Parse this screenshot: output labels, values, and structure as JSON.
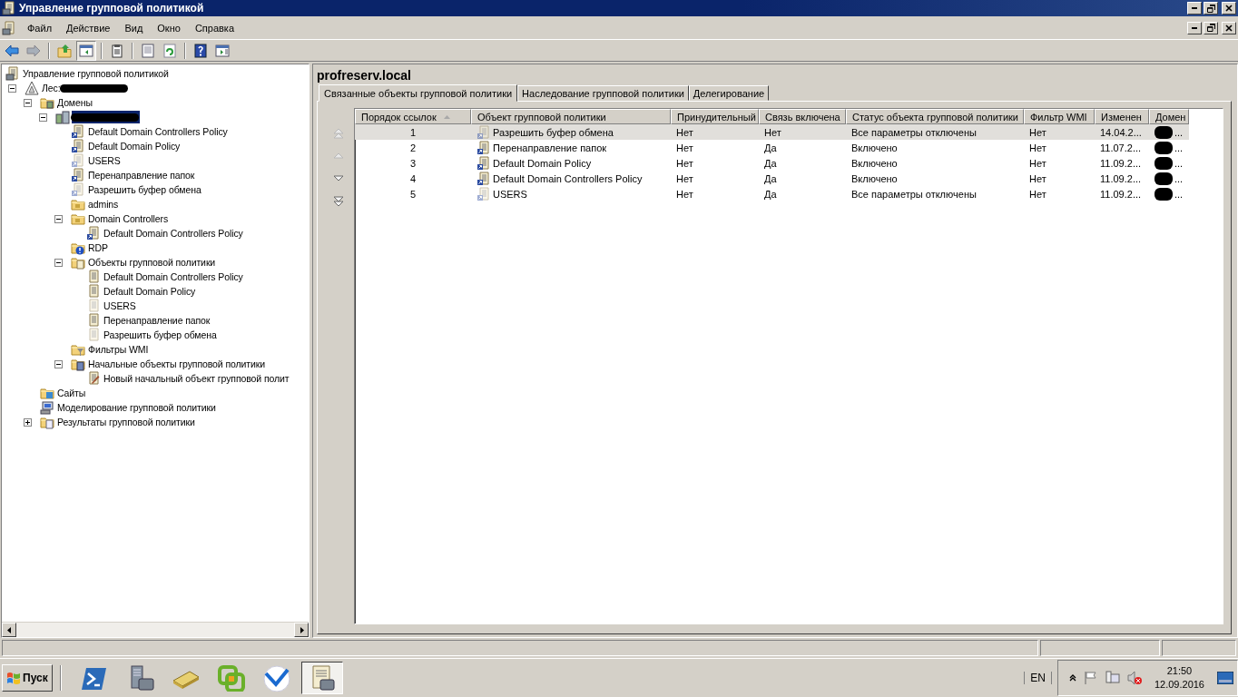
{
  "window": {
    "title": "Управление групповой политикой"
  },
  "menu": [
    "Файл",
    "Действие",
    "Вид",
    "Окно",
    "Справка"
  ],
  "toolbar": [
    {
      "kind": "back",
      "disabled": false,
      "pressed": false
    },
    {
      "kind": "forward",
      "disabled": true,
      "pressed": false
    },
    {
      "kind": "separator"
    },
    {
      "kind": "up",
      "disabled": false,
      "pressed": false
    },
    {
      "kind": "console-tree",
      "disabled": false,
      "pressed": true
    },
    {
      "kind": "separator"
    },
    {
      "kind": "clipboard",
      "disabled": false,
      "pressed": false
    },
    {
      "kind": "separator"
    },
    {
      "kind": "export",
      "disabled": false,
      "pressed": false
    },
    {
      "kind": "refresh",
      "disabled": false,
      "pressed": false
    },
    {
      "kind": "separator"
    },
    {
      "kind": "help",
      "disabled": false,
      "pressed": false
    },
    {
      "kind": "action-pane",
      "disabled": false,
      "pressed": false
    }
  ],
  "tree": {
    "label": "Управление групповой политикой",
    "kind": "root",
    "selected": false,
    "children": [
      {
        "label": "Лес:",
        "kind": "forest",
        "redacted": true,
        "selected": false,
        "expanded": true,
        "children": [
          {
            "label": "Домены",
            "kind": "domains",
            "selected": false,
            "expanded": true,
            "children": [
              {
                "kind": "domain",
                "redacted": true,
                "selected": true,
                "expanded": true,
                "children": [
                  {
                    "label": "Default Domain Controllers Policy",
                    "kind": "link",
                    "faded": false,
                    "selected": false
                  },
                  {
                    "label": "Default Domain Policy",
                    "kind": "link",
                    "faded": false,
                    "selected": false
                  },
                  {
                    "label": "USERS",
                    "kind": "link",
                    "faded": true,
                    "selected": false
                  },
                  {
                    "label": "Перенаправление папок",
                    "kind": "link",
                    "faded": false,
                    "selected": false
                  },
                  {
                    "label": "Разрешить буфер обмена",
                    "kind": "link",
                    "faded": true,
                    "selected": false
                  },
                  {
                    "label": "admins",
                    "kind": "ou",
                    "selected": false
                  },
                  {
                    "label": "Domain Controllers",
                    "kind": "ou",
                    "selected": false,
                    "expanded": true,
                    "children": [
                      {
                        "label": "Default Domain Controllers Policy",
                        "kind": "link",
                        "faded": false,
                        "selected": false
                      }
                    ]
                  },
                  {
                    "label": "RDP",
                    "kind": "ou-warning",
                    "selected": false
                  },
                  {
                    "label": "Объекты групповой политики",
                    "kind": "gpo-folder",
                    "selected": false,
                    "expanded": true,
                    "children": [
                      {
                        "label": "Default Domain Controllers Policy",
                        "kind": "gpo",
                        "faded": false,
                        "selected": false
                      },
                      {
                        "label": "Default Domain Policy",
                        "kind": "gpo",
                        "faded": false,
                        "selected": false
                      },
                      {
                        "label": "USERS",
                        "kind": "gpo",
                        "faded": true,
                        "selected": false
                      },
                      {
                        "label": "Перенаправление папок",
                        "kind": "gpo",
                        "faded": false,
                        "selected": false
                      },
                      {
                        "label": "Разрешить буфер обмена",
                        "kind": "gpo",
                        "faded": true,
                        "selected": false
                      }
                    ]
                  },
                  {
                    "label": "Фильтры WMI",
                    "kind": "wmi",
                    "selected": false
                  },
                  {
                    "label": "Начальные объекты групповой политики",
                    "kind": "starter-folder",
                    "selected": false,
                    "expanded": true,
                    "children": [
                      {
                        "label": "Новый начальный объект групповой полит",
                        "kind": "starter",
                        "selected": false
                      }
                    ]
                  }
                ]
              }
            ]
          },
          {
            "label": "Сайты",
            "kind": "sites",
            "selected": false
          },
          {
            "label": "Моделирование групповой политики",
            "kind": "modeling",
            "selected": false
          },
          {
            "label": "Результаты групповой политики",
            "kind": "results",
            "selected": false,
            "expanded": false
          }
        ]
      }
    ]
  },
  "details": {
    "title": "profreserv.local",
    "tabs": [
      {
        "label": "Связанные объекты групповой политики",
        "selected": true
      },
      {
        "label": "Наследование групповой политики",
        "selected": false
      },
      {
        "label": "Делегирование",
        "selected": false
      }
    ],
    "order_buttons": [
      {
        "kind": "top",
        "disabled": true
      },
      {
        "kind": "up",
        "disabled": true
      },
      {
        "kind": "down",
        "disabled": false
      },
      {
        "kind": "bottom",
        "disabled": false
      }
    ],
    "columns": [
      {
        "label": "Порядок ссылок",
        "sorted": true
      },
      {
        "label": "Объект групповой политики",
        "sorted": false
      },
      {
        "label": "Принудительный",
        "sorted": false
      },
      {
        "label": "Связь включена",
        "sorted": false
      },
      {
        "label": "Статус объекта групповой политики",
        "sorted": false
      },
      {
        "label": "Фильтр WMI",
        "sorted": false
      },
      {
        "label": "Изменен",
        "sorted": false
      },
      {
        "label": "Домен",
        "sorted": false
      }
    ],
    "rows": [
      {
        "order": "1",
        "name": "Разрешить буфер обмена",
        "faded": true,
        "enforced": "Нет",
        "link_enabled": "Нет",
        "status": "Все параметры отключены",
        "wmi_filter": "Нет",
        "modified": "14.04.2...",
        "domain": "...",
        "domain_redacted": true,
        "selected": true
      },
      {
        "order": "2",
        "name": "Перенаправление папок",
        "faded": false,
        "enforced": "Нет",
        "link_enabled": "Да",
        "status": "Включено",
        "wmi_filter": "Нет",
        "modified": "11.07.2...",
        "domain": "...",
        "domain_redacted": true,
        "selected": false
      },
      {
        "order": "3",
        "name": "Default Domain Policy",
        "faded": false,
        "enforced": "Нет",
        "link_enabled": "Да",
        "status": "Включено",
        "wmi_filter": "Нет",
        "modified": "11.09.2...",
        "domain": "...",
        "domain_redacted": true,
        "selected": false
      },
      {
        "order": "4",
        "name": "Default Domain Controllers Policy",
        "faded": false,
        "enforced": "Нет",
        "link_enabled": "Да",
        "status": "Включено",
        "wmi_filter": "Нет",
        "modified": "11.09.2...",
        "domain": "...",
        "domain_redacted": true,
        "selected": false
      },
      {
        "order": "5",
        "name": "USERS",
        "faded": true,
        "enforced": "Нет",
        "link_enabled": "Да",
        "status": "Все параметры отключены",
        "wmi_filter": "Нет",
        "modified": "11.09.2...",
        "domain": "...",
        "domain_redacted": true,
        "selected": false
      }
    ]
  },
  "taskbar": {
    "start": "Пуск",
    "apps": [
      {
        "kind": "powershell",
        "active": false
      },
      {
        "kind": "server-manager",
        "active": false
      },
      {
        "kind": "scanner",
        "active": false
      },
      {
        "kind": "vmware",
        "active": false
      },
      {
        "kind": "acronis",
        "active": false
      },
      {
        "kind": "gpmc",
        "active": true
      }
    ],
    "language": "EN",
    "time": "21:50",
    "date": "12.09.2016"
  }
}
